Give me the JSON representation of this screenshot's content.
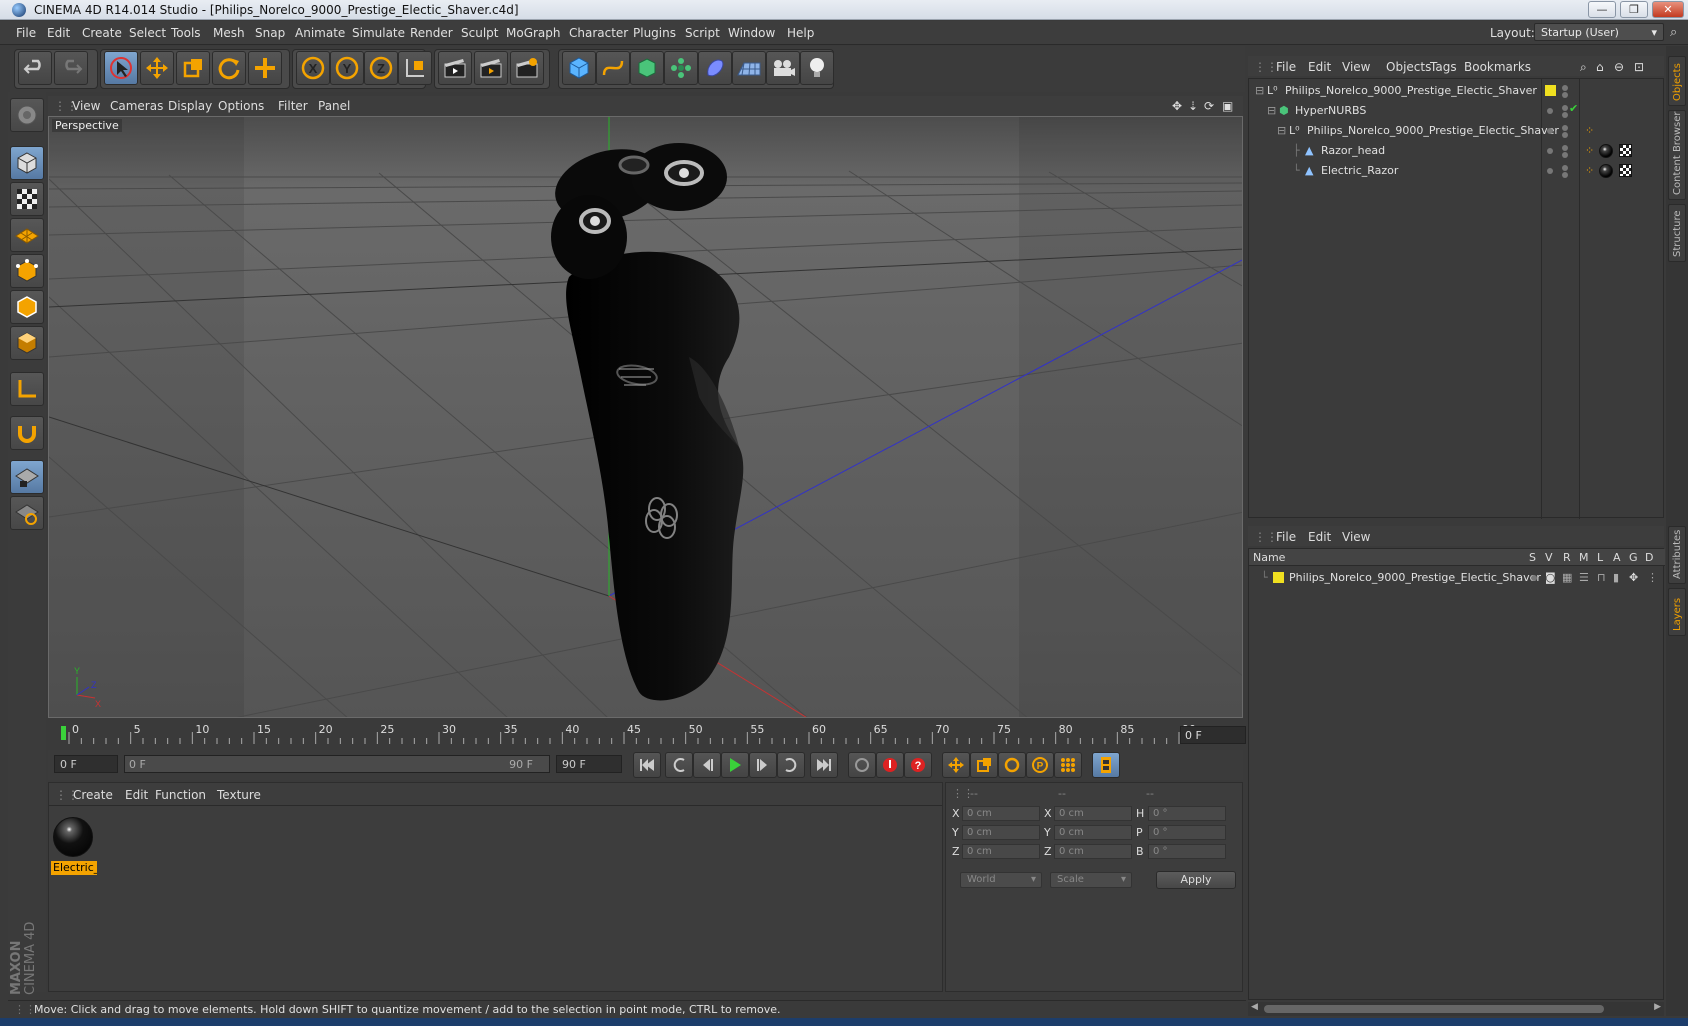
{
  "window": {
    "title": "CINEMA 4D R14.014 Studio - [Philips_Norelco_9000_Prestige_Electic_Shaver.c4d]",
    "minimize": "—",
    "maximize": "❐",
    "close": "✕"
  },
  "menubar": {
    "items": [
      "File",
      "Edit",
      "Create",
      "Select",
      "Tools",
      "Mesh",
      "Snap",
      "Animate",
      "Simulate",
      "Render",
      "Sculpt",
      "MoGraph",
      "Character",
      "Plugins",
      "Script",
      "Window",
      "Help"
    ],
    "layout_label": "Layout:",
    "layout_value": "Startup (User)"
  },
  "viewport": {
    "menu": [
      "View",
      "Cameras",
      "Display",
      "Options",
      "Filter",
      "Panel"
    ],
    "label": "Perspective",
    "axis_labels": {
      "y": "Y",
      "x": "X",
      "z": "Z"
    }
  },
  "timeline": {
    "ticks": [
      "0",
      "5",
      "10",
      "15",
      "20",
      "25",
      "30",
      "35",
      "40",
      "45",
      "50",
      "55",
      "60",
      "65",
      "70",
      "75",
      "80",
      "85",
      "90"
    ],
    "current_frame": "0 F",
    "start_field": "0 F",
    "range_start": "0 F",
    "range_end": "90 F",
    "end_field": "90 F"
  },
  "material_manager": {
    "menu": [
      "Create",
      "Edit",
      "Function",
      "Texture"
    ],
    "materials": [
      {
        "name": "Electric_"
      }
    ]
  },
  "coordinates": {
    "headers": [
      "--",
      "--",
      "--"
    ],
    "rows": [
      {
        "l1": "X",
        "v1": "0 cm",
        "l2": "X",
        "v2": "0 cm",
        "l3": "H",
        "v3": "0 °"
      },
      {
        "l1": "Y",
        "v1": "0 cm",
        "l2": "Y",
        "v2": "0 cm",
        "l3": "P",
        "v3": "0 °"
      },
      {
        "l1": "Z",
        "v1": "0 cm",
        "l2": "Z",
        "v2": "0 cm",
        "l3": "B",
        "v3": "0 °"
      }
    ],
    "space": "World",
    "mode": "Scale",
    "apply": "Apply"
  },
  "status": "Move: Click and drag to move elements. Hold down SHIFT to quantize movement / add to the selection in point mode, CTRL to remove.",
  "object_manager": {
    "menu": [
      "File",
      "Edit",
      "View",
      "Objects",
      "Tags",
      "Bookmarks"
    ],
    "objects": [
      {
        "name": "Philips_Norelco_9000_Prestige_Electic_Shaver",
        "type": "null"
      },
      {
        "name": "HyperNURBS",
        "type": "nurbs"
      },
      {
        "name": "Philips_Norelco_9000_Prestige_Electic_Shaver",
        "type": "null"
      },
      {
        "name": "Razor_head",
        "type": "mesh"
      },
      {
        "name": "Electric_Razor",
        "type": "mesh"
      }
    ]
  },
  "layer_manager": {
    "menu": [
      "File",
      "Edit",
      "View"
    ],
    "columns": [
      "Name",
      "S",
      "V",
      "R",
      "M",
      "L",
      "A",
      "G",
      "D"
    ],
    "layers": [
      {
        "name": "Philips_Norelco_9000_Prestige_Electic_Shaver"
      }
    ]
  },
  "side_tabs": [
    "Objects",
    "Content Browser",
    "Structure",
    "Attributes",
    "Layers"
  ],
  "colors": {
    "accent": "#f4a300",
    "active_blue": "#5679a3",
    "axis_x": "#c83232",
    "axis_y": "#28b428",
    "axis_z": "#3232c8"
  }
}
